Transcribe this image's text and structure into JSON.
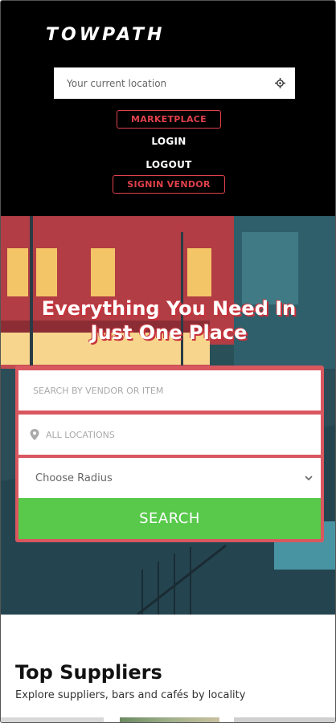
{
  "header": {
    "logo_text": "TOWPATH",
    "location_placeholder": "Your current location",
    "nav": {
      "marketplace": "MARKETPLACE",
      "login": "LOGIN",
      "logout": "LOGOUT",
      "signin_vendor": "SIGNIN VENDOR"
    }
  },
  "hero": {
    "title_line1": "Everything You Need In",
    "title_line2": "Just One Place"
  },
  "search": {
    "vendor_placeholder": "SEARCH BY VENDOR OR ITEM",
    "location_placeholder": "ALL LOCATIONS",
    "radius_selected": "Choose Radius",
    "button_label": "SEARCH"
  },
  "suppliers": {
    "title": "Top Suppliers",
    "subtitle": "Explore suppliers, bars and cafés by locality"
  },
  "colors": {
    "accent_red": "#e0404b",
    "search_green": "#58c94b",
    "header_bg": "#000000"
  }
}
